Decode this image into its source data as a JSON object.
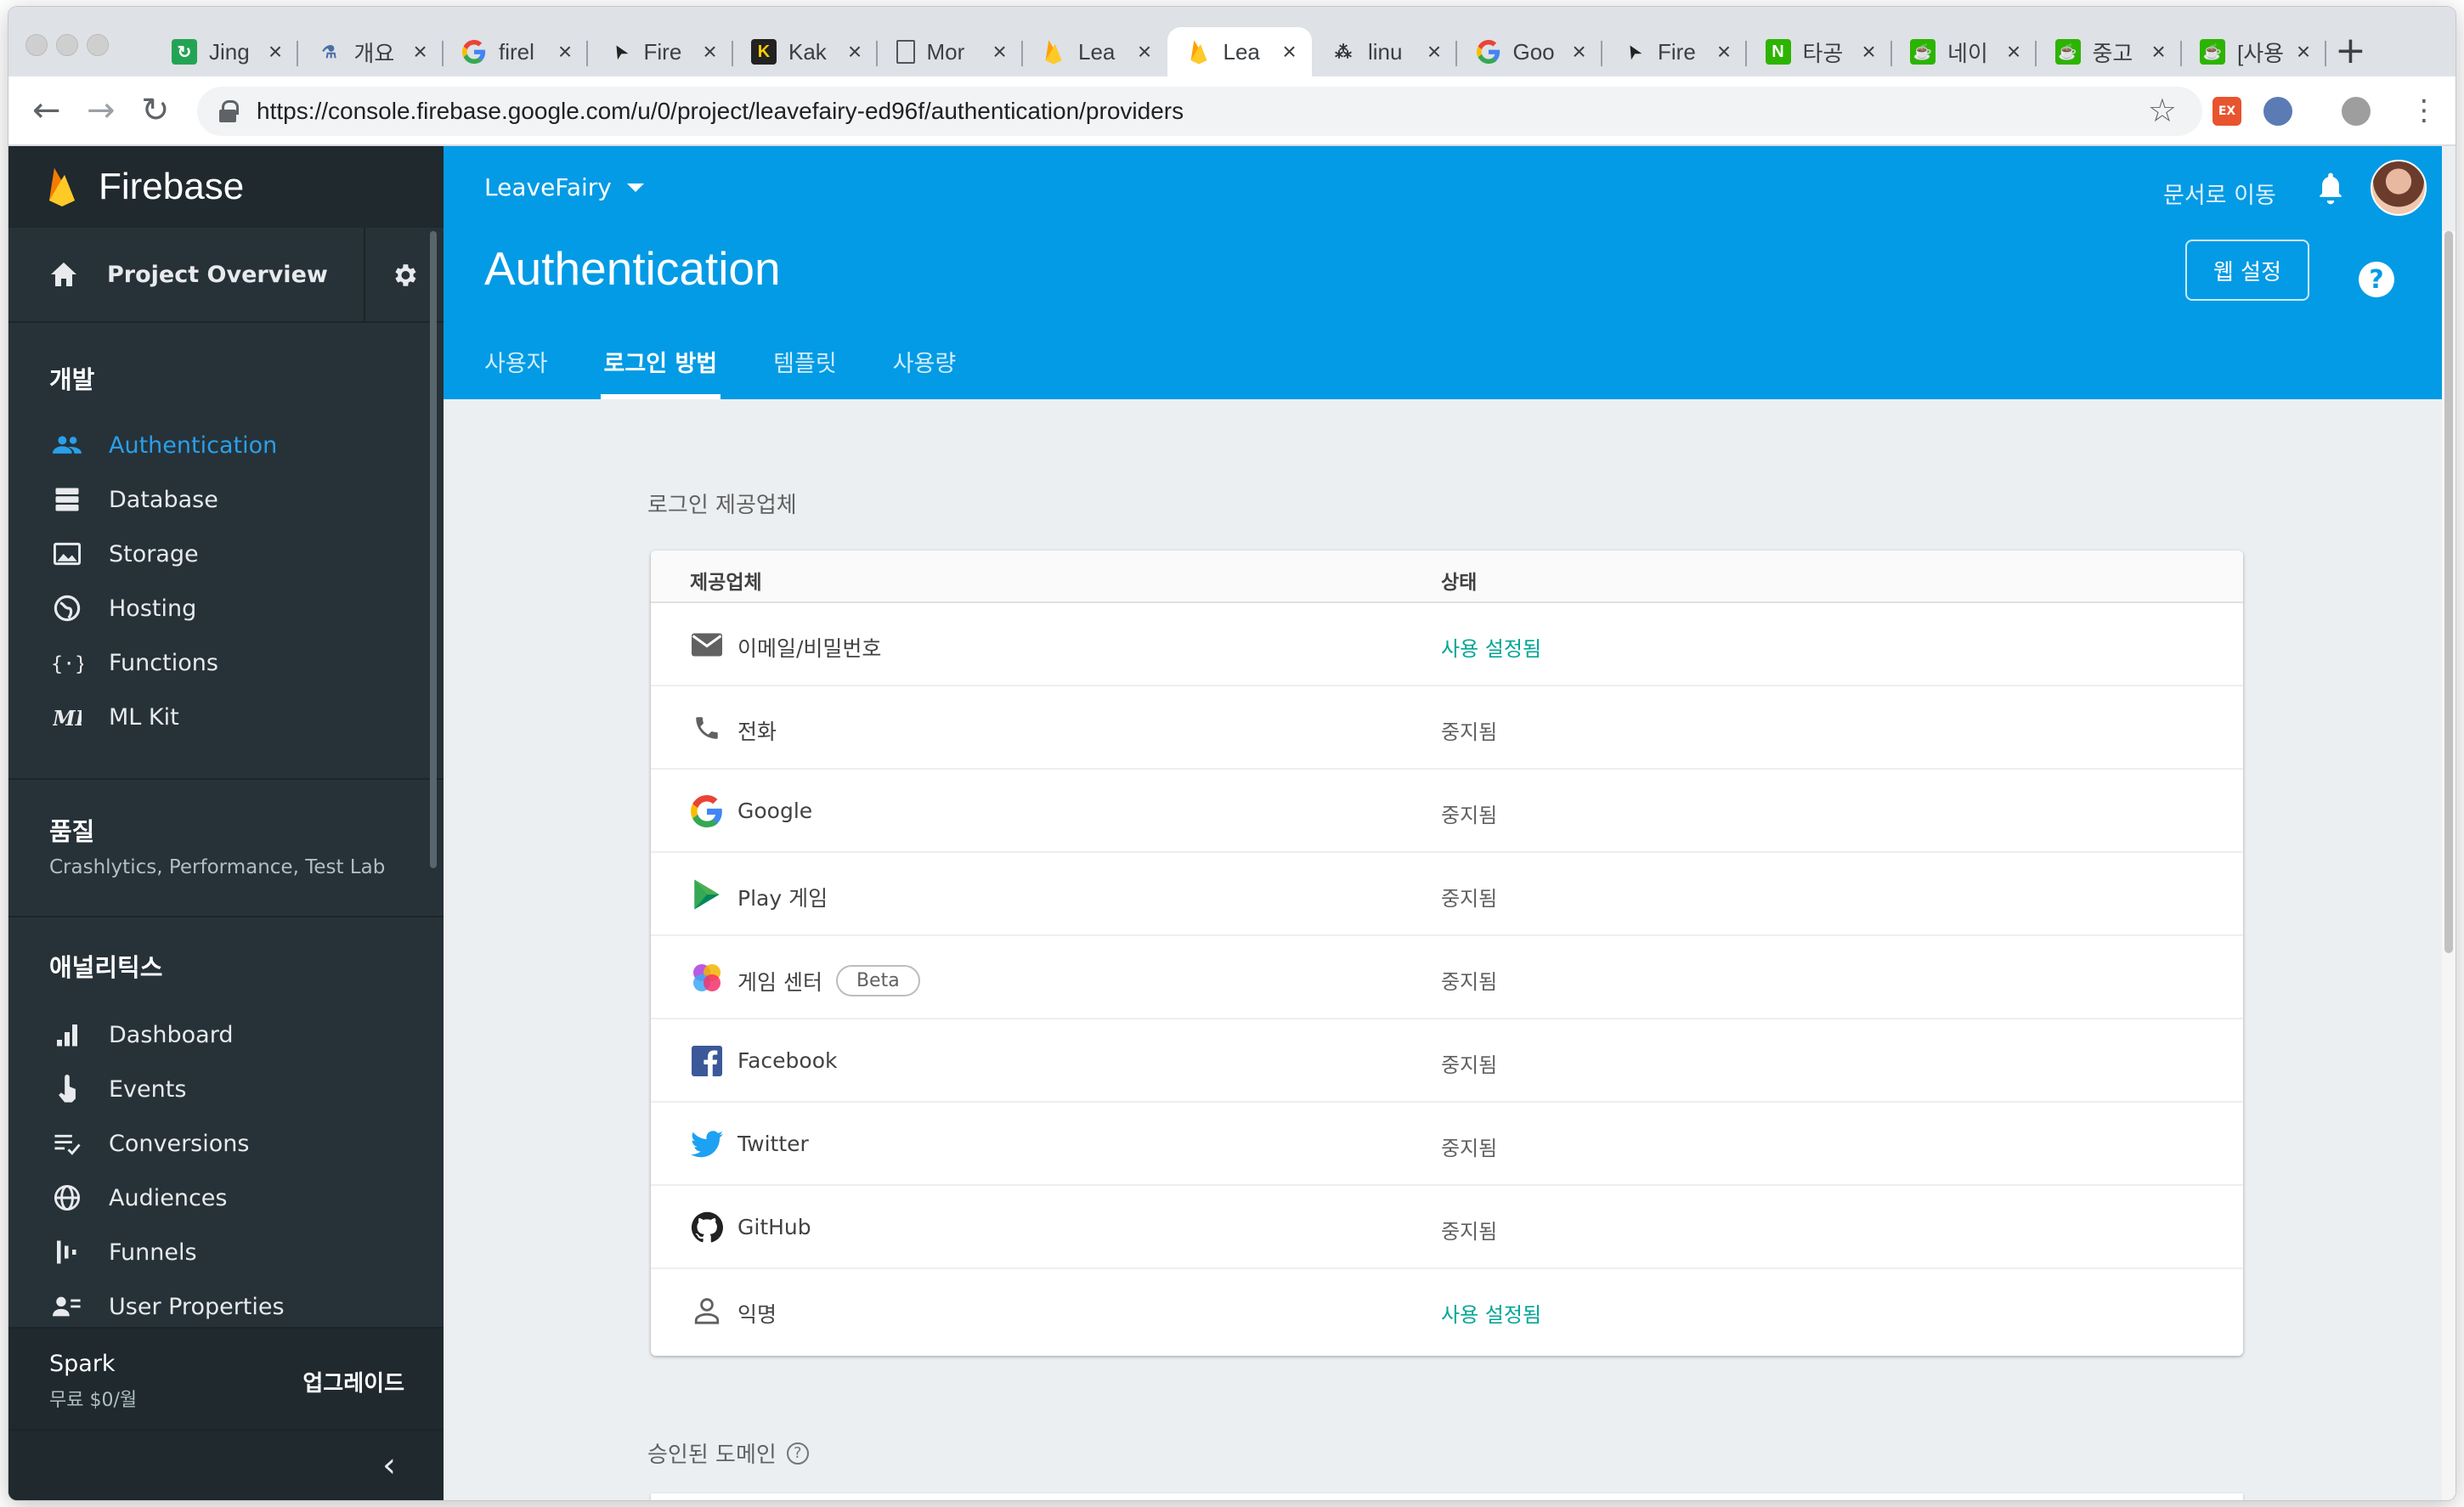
{
  "browser": {
    "tabs": [
      {
        "title": "Jing",
        "favicon": "green-refresh-icon",
        "color": "#23a455"
      },
      {
        "title": "개요",
        "favicon": "flask-icon",
        "color": "#4a6fa5"
      },
      {
        "title": "firel",
        "favicon": "google-icon",
        "color": "#4285f4"
      },
      {
        "title": "Fire",
        "favicon": "cursor-icon",
        "color": "#222222"
      },
      {
        "title": "Kak",
        "favicon": "kakao-icon",
        "color": "#222222"
      },
      {
        "title": "Mor",
        "favicon": "page-icon",
        "color": "#555555"
      },
      {
        "title": "Lea",
        "favicon": "firebase-icon",
        "color": "#ffa000"
      },
      {
        "title": "Lea",
        "favicon": "firebase-icon",
        "color": "#ffa000",
        "active": true
      },
      {
        "title": "linu",
        "favicon": "network-icon",
        "color": "#333333"
      },
      {
        "title": "Goo",
        "favicon": "google-icon",
        "color": "#4285f4"
      },
      {
        "title": "Fire",
        "favicon": "cursor-icon",
        "color": "#222222"
      },
      {
        "title": "타공",
        "favicon": "naver-icon",
        "color": "#2db400"
      },
      {
        "title": "네이",
        "favicon": "naver-cafe-icon",
        "color": "#2db400"
      },
      {
        "title": "중고",
        "favicon": "naver-cafe-icon",
        "color": "#2db400"
      },
      {
        "title": "[사용",
        "favicon": "naver-cafe-icon",
        "color": "#2db400"
      }
    ],
    "url": "https://console.firebase.google.com/u/0/project/leavefairy-ed96f/authentication/providers"
  },
  "sidebar": {
    "brand": "Firebase",
    "overview": "Project Overview",
    "develop_header": "개발",
    "develop_items": [
      {
        "label": "Authentication",
        "icon": "people-icon",
        "active": true
      },
      {
        "label": "Database",
        "icon": "database-icon"
      },
      {
        "label": "Storage",
        "icon": "image-icon"
      },
      {
        "label": "Hosting",
        "icon": "globe-hosting-icon"
      },
      {
        "label": "Functions",
        "icon": "functions-icon"
      },
      {
        "label": "ML Kit",
        "icon": "ml-kit-icon"
      }
    ],
    "quality_header": "품질",
    "quality_sub": "Crashlytics, Performance, Test Lab",
    "analytics_header": "애널리틱스",
    "analytics_items": [
      {
        "label": "Dashboard",
        "icon": "bar-chart-icon"
      },
      {
        "label": "Events",
        "icon": "touch-icon"
      },
      {
        "label": "Conversions",
        "icon": "conversions-icon"
      },
      {
        "label": "Audiences",
        "icon": "globe-icon"
      },
      {
        "label": "Funnels",
        "icon": "funnel-icon"
      },
      {
        "label": "User Properties",
        "icon": "user-properties-icon"
      }
    ],
    "plan_name": "Spark",
    "plan_price": "무료 $0/월",
    "upgrade": "업그레이드"
  },
  "header": {
    "project": "LeaveFairy",
    "docs_link": "문서로 이동",
    "title": "Authentication",
    "web_setup": "웹 설정",
    "help": "?",
    "tabs": [
      "사용자",
      "로그인 방법",
      "템플릿",
      "사용량"
    ],
    "active_tab": 1
  },
  "providers": {
    "section_title": "로그인 제공업체",
    "col_provider": "제공업체",
    "col_status": "상태",
    "rows": [
      {
        "name": "이메일/비밀번호",
        "status": "사용 설정됨",
        "enabled": true,
        "icon": "email-icon"
      },
      {
        "name": "전화",
        "status": "중지됨",
        "enabled": false,
        "icon": "phone-icon"
      },
      {
        "name": "Google",
        "status": "중지됨",
        "enabled": false,
        "icon": "google-icon"
      },
      {
        "name": "Play 게임",
        "status": "중지됨",
        "enabled": false,
        "icon": "play-games-icon"
      },
      {
        "name": "게임 센터",
        "status": "중지됨",
        "enabled": false,
        "icon": "game-center-icon",
        "badge": "Beta"
      },
      {
        "name": "Facebook",
        "status": "중지됨",
        "enabled": false,
        "icon": "facebook-icon"
      },
      {
        "name": "Twitter",
        "status": "중지됨",
        "enabled": false,
        "icon": "twitter-icon"
      },
      {
        "name": "GitHub",
        "status": "중지됨",
        "enabled": false,
        "icon": "github-icon"
      },
      {
        "name": "익명",
        "status": "사용 설정됨",
        "enabled": true,
        "icon": "anonymous-icon"
      }
    ],
    "enabled_color": "#00a596"
  },
  "domains": {
    "title": "승인된 도메인",
    "help": "?"
  }
}
